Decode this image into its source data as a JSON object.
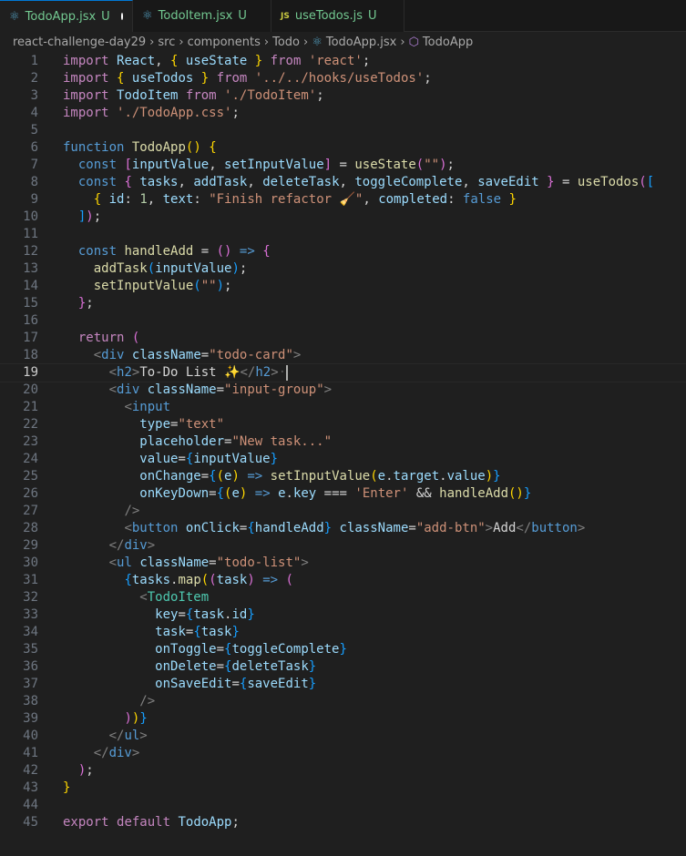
{
  "tabs": [
    {
      "label": "TodoApp.jsx",
      "status": "U",
      "icon": "react-icon",
      "modified": true,
      "active": true
    },
    {
      "label": "TodoItem.jsx",
      "status": "U",
      "icon": "react-icon",
      "modified": false,
      "active": false
    },
    {
      "label": "useTodos.js",
      "status": "U",
      "icon": "js-icon",
      "icon_text": "JS",
      "modified": false,
      "active": false
    }
  ],
  "breadcrumb": [
    "react-challenge-day29",
    "src",
    "components",
    "Todo",
    "TodoApp.jsx",
    "TodoApp"
  ],
  "current_line": 19,
  "lines": [
    [
      [
        "k",
        "import"
      ],
      [
        "o",
        " "
      ],
      [
        "v",
        "React"
      ],
      [
        "o",
        ", "
      ],
      [
        "b1",
        "{"
      ],
      [
        "o",
        " "
      ],
      [
        "v",
        "useState"
      ],
      [
        "o",
        " "
      ],
      [
        "b1",
        "}"
      ],
      [
        "o",
        " "
      ],
      [
        "k",
        "from"
      ],
      [
        "o",
        " "
      ],
      [
        "st",
        "'react'"
      ],
      [
        "o",
        ";"
      ]
    ],
    [
      [
        "k",
        "import"
      ],
      [
        "o",
        " "
      ],
      [
        "b1",
        "{"
      ],
      [
        "o",
        " "
      ],
      [
        "v",
        "useTodos"
      ],
      [
        "o",
        " "
      ],
      [
        "b1",
        "}"
      ],
      [
        "o",
        " "
      ],
      [
        "k",
        "from"
      ],
      [
        "o",
        " "
      ],
      [
        "st",
        "'../../hooks/useTodos'"
      ],
      [
        "o",
        ";"
      ]
    ],
    [
      [
        "k",
        "import"
      ],
      [
        "o",
        " "
      ],
      [
        "v",
        "TodoItem"
      ],
      [
        "o",
        " "
      ],
      [
        "k",
        "from"
      ],
      [
        "o",
        " "
      ],
      [
        "st",
        "'./TodoItem'"
      ],
      [
        "o",
        ";"
      ]
    ],
    [
      [
        "k",
        "import"
      ],
      [
        "o",
        " "
      ],
      [
        "st",
        "'./TodoApp.css'"
      ],
      [
        "o",
        ";"
      ]
    ],
    [],
    [
      [
        "s",
        "function"
      ],
      [
        "o",
        " "
      ],
      [
        "f",
        "TodoApp"
      ],
      [
        "b1",
        "()"
      ],
      [
        "o",
        " "
      ],
      [
        "b1",
        "{"
      ]
    ],
    [
      [
        "o",
        "  "
      ],
      [
        "s",
        "const"
      ],
      [
        "o",
        " "
      ],
      [
        "b2",
        "["
      ],
      [
        "v",
        "inputValue"
      ],
      [
        "o",
        ", "
      ],
      [
        "v",
        "setInputValue"
      ],
      [
        "b2",
        "]"
      ],
      [
        "o",
        " = "
      ],
      [
        "f",
        "useState"
      ],
      [
        "b2",
        "("
      ],
      [
        "st",
        "\"\""
      ],
      [
        "b2",
        ")"
      ],
      [
        "o",
        ";"
      ]
    ],
    [
      [
        "o",
        "  "
      ],
      [
        "s",
        "const"
      ],
      [
        "o",
        " "
      ],
      [
        "b2",
        "{"
      ],
      [
        "o",
        " "
      ],
      [
        "v",
        "tasks"
      ],
      [
        "o",
        ", "
      ],
      [
        "v",
        "addTask"
      ],
      [
        "o",
        ", "
      ],
      [
        "v",
        "deleteTask"
      ],
      [
        "o",
        ", "
      ],
      [
        "v",
        "toggleComplete"
      ],
      [
        "o",
        ", "
      ],
      [
        "v",
        "saveEdit"
      ],
      [
        "o",
        " "
      ],
      [
        "b2",
        "}"
      ],
      [
        "o",
        " = "
      ],
      [
        "f",
        "useTodos"
      ],
      [
        "b2",
        "("
      ],
      [
        "b3",
        "["
      ]
    ],
    [
      [
        "o",
        "    "
      ],
      [
        "b1",
        "{"
      ],
      [
        "o",
        " "
      ],
      [
        "v",
        "id"
      ],
      [
        "o",
        ": "
      ],
      [
        "n",
        "1"
      ],
      [
        "o",
        ", "
      ],
      [
        "v",
        "text"
      ],
      [
        "o",
        ": "
      ],
      [
        "st",
        "\"Finish refactor 🧹\""
      ],
      [
        "o",
        ", "
      ],
      [
        "v",
        "completed"
      ],
      [
        "o",
        ": "
      ],
      [
        "s",
        "false"
      ],
      [
        "o",
        " "
      ],
      [
        "b1",
        "}"
      ]
    ],
    [
      [
        "o",
        "  "
      ],
      [
        "b3",
        "]"
      ],
      [
        "b2",
        ")"
      ],
      [
        "o",
        ";"
      ]
    ],
    [],
    [
      [
        "o",
        "  "
      ],
      [
        "s",
        "const"
      ],
      [
        "o",
        " "
      ],
      [
        "f",
        "handleAdd"
      ],
      [
        "o",
        " = "
      ],
      [
        "b2",
        "()"
      ],
      [
        "o",
        " "
      ],
      [
        "s",
        "=>"
      ],
      [
        "o",
        " "
      ],
      [
        "b2",
        "{"
      ]
    ],
    [
      [
        "o",
        "    "
      ],
      [
        "f",
        "addTask"
      ],
      [
        "b3",
        "("
      ],
      [
        "v",
        "inputValue"
      ],
      [
        "b3",
        ")"
      ],
      [
        "o",
        ";"
      ]
    ],
    [
      [
        "o",
        "    "
      ],
      [
        "f",
        "setInputValue"
      ],
      [
        "b3",
        "("
      ],
      [
        "st",
        "\"\""
      ],
      [
        "b3",
        ")"
      ],
      [
        "o",
        ";"
      ]
    ],
    [
      [
        "o",
        "  "
      ],
      [
        "b2",
        "}"
      ],
      [
        "o",
        ";"
      ]
    ],
    [],
    [
      [
        "o",
        "  "
      ],
      [
        "k",
        "return"
      ],
      [
        "o",
        " "
      ],
      [
        "b2",
        "("
      ]
    ],
    [
      [
        "o",
        "    "
      ],
      [
        "p",
        "<"
      ],
      [
        "t",
        "div"
      ],
      [
        "o",
        " "
      ],
      [
        "v",
        "className"
      ],
      [
        "o",
        "="
      ],
      [
        "st",
        "\"todo-card\""
      ],
      [
        "p",
        ">"
      ]
    ],
    [
      [
        "o",
        "      "
      ],
      [
        "p",
        "<"
      ],
      [
        "t",
        "h2"
      ],
      [
        "p",
        ">"
      ],
      [
        "o",
        "To-Do List ✨"
      ],
      [
        "p",
        "</"
      ],
      [
        "t",
        "h2"
      ],
      [
        "p",
        ">"
      ],
      [
        "ws",
        "·"
      ]
    ],
    [
      [
        "o",
        "      "
      ],
      [
        "p",
        "<"
      ],
      [
        "t",
        "div"
      ],
      [
        "o",
        " "
      ],
      [
        "v",
        "className"
      ],
      [
        "o",
        "="
      ],
      [
        "st",
        "\"input-group\""
      ],
      [
        "p",
        ">"
      ]
    ],
    [
      [
        "o",
        "        "
      ],
      [
        "p",
        "<"
      ],
      [
        "t",
        "input"
      ]
    ],
    [
      [
        "o",
        "          "
      ],
      [
        "v",
        "type"
      ],
      [
        "o",
        "="
      ],
      [
        "st",
        "\"text\""
      ]
    ],
    [
      [
        "o",
        "          "
      ],
      [
        "v",
        "placeholder"
      ],
      [
        "o",
        "="
      ],
      [
        "st",
        "\"New task...\""
      ]
    ],
    [
      [
        "o",
        "          "
      ],
      [
        "v",
        "value"
      ],
      [
        "o",
        "="
      ],
      [
        "b3",
        "{"
      ],
      [
        "v",
        "inputValue"
      ],
      [
        "b3",
        "}"
      ]
    ],
    [
      [
        "o",
        "          "
      ],
      [
        "v",
        "onChange"
      ],
      [
        "o",
        "="
      ],
      [
        "b3",
        "{"
      ],
      [
        "b1",
        "("
      ],
      [
        "v",
        "e"
      ],
      [
        "b1",
        ")"
      ],
      [
        "o",
        " "
      ],
      [
        "s",
        "=>"
      ],
      [
        "o",
        " "
      ],
      [
        "f",
        "setInputValue"
      ],
      [
        "b1",
        "("
      ],
      [
        "v",
        "e"
      ],
      [
        "o",
        "."
      ],
      [
        "v",
        "target"
      ],
      [
        "o",
        "."
      ],
      [
        "v",
        "value"
      ],
      [
        "b1",
        ")"
      ],
      [
        "b3",
        "}"
      ]
    ],
    [
      [
        "o",
        "          "
      ],
      [
        "v",
        "onKeyDown"
      ],
      [
        "o",
        "="
      ],
      [
        "b3",
        "{"
      ],
      [
        "b1",
        "("
      ],
      [
        "v",
        "e"
      ],
      [
        "b1",
        ")"
      ],
      [
        "o",
        " "
      ],
      [
        "s",
        "=>"
      ],
      [
        "o",
        " "
      ],
      [
        "v",
        "e"
      ],
      [
        "o",
        "."
      ],
      [
        "v",
        "key"
      ],
      [
        "o",
        " === "
      ],
      [
        "st",
        "'Enter'"
      ],
      [
        "o",
        " && "
      ],
      [
        "f",
        "handleAdd"
      ],
      [
        "b1",
        "()"
      ],
      [
        "b3",
        "}"
      ]
    ],
    [
      [
        "o",
        "        "
      ],
      [
        "p",
        "/>"
      ]
    ],
    [
      [
        "o",
        "        "
      ],
      [
        "p",
        "<"
      ],
      [
        "t",
        "button"
      ],
      [
        "o",
        " "
      ],
      [
        "v",
        "onClick"
      ],
      [
        "o",
        "="
      ],
      [
        "b3",
        "{"
      ],
      [
        "v",
        "handleAdd"
      ],
      [
        "b3",
        "}"
      ],
      [
        "o",
        " "
      ],
      [
        "v",
        "className"
      ],
      [
        "o",
        "="
      ],
      [
        "st",
        "\"add-btn\""
      ],
      [
        "p",
        ">"
      ],
      [
        "o",
        "Add"
      ],
      [
        "p",
        "</"
      ],
      [
        "t",
        "button"
      ],
      [
        "p",
        ">"
      ]
    ],
    [
      [
        "o",
        "      "
      ],
      [
        "p",
        "</"
      ],
      [
        "t",
        "div"
      ],
      [
        "p",
        ">"
      ]
    ],
    [
      [
        "o",
        "      "
      ],
      [
        "p",
        "<"
      ],
      [
        "t",
        "ul"
      ],
      [
        "o",
        " "
      ],
      [
        "v",
        "className"
      ],
      [
        "o",
        "="
      ],
      [
        "st",
        "\"todo-list\""
      ],
      [
        "p",
        ">"
      ]
    ],
    [
      [
        "o",
        "        "
      ],
      [
        "b3",
        "{"
      ],
      [
        "v",
        "tasks"
      ],
      [
        "o",
        "."
      ],
      [
        "f",
        "map"
      ],
      [
        "b1",
        "("
      ],
      [
        "b2",
        "("
      ],
      [
        "v",
        "task"
      ],
      [
        "b2",
        ")"
      ],
      [
        "o",
        " "
      ],
      [
        "s",
        "=>"
      ],
      [
        "o",
        " "
      ],
      [
        "b2",
        "("
      ]
    ],
    [
      [
        "o",
        "          "
      ],
      [
        "p",
        "<"
      ],
      [
        "c",
        "TodoItem"
      ]
    ],
    [
      [
        "o",
        "            "
      ],
      [
        "v",
        "key"
      ],
      [
        "o",
        "="
      ],
      [
        "b3",
        "{"
      ],
      [
        "v",
        "task"
      ],
      [
        "o",
        "."
      ],
      [
        "v",
        "id"
      ],
      [
        "b3",
        "}"
      ]
    ],
    [
      [
        "o",
        "            "
      ],
      [
        "v",
        "task"
      ],
      [
        "o",
        "="
      ],
      [
        "b3",
        "{"
      ],
      [
        "v",
        "task"
      ],
      [
        "b3",
        "}"
      ]
    ],
    [
      [
        "o",
        "            "
      ],
      [
        "v",
        "onToggle"
      ],
      [
        "o",
        "="
      ],
      [
        "b3",
        "{"
      ],
      [
        "v",
        "toggleComplete"
      ],
      [
        "b3",
        "}"
      ]
    ],
    [
      [
        "o",
        "            "
      ],
      [
        "v",
        "onDelete"
      ],
      [
        "o",
        "="
      ],
      [
        "b3",
        "{"
      ],
      [
        "v",
        "deleteTask"
      ],
      [
        "b3",
        "}"
      ]
    ],
    [
      [
        "o",
        "            "
      ],
      [
        "v",
        "onSaveEdit"
      ],
      [
        "o",
        "="
      ],
      [
        "b3",
        "{"
      ],
      [
        "v",
        "saveEdit"
      ],
      [
        "b3",
        "}"
      ]
    ],
    [
      [
        "o",
        "          "
      ],
      [
        "p",
        "/>"
      ]
    ],
    [
      [
        "o",
        "        "
      ],
      [
        "b2",
        ")"
      ],
      [
        "b1",
        ")"
      ],
      [
        "b3",
        "}"
      ]
    ],
    [
      [
        "o",
        "      "
      ],
      [
        "p",
        "</"
      ],
      [
        "t",
        "ul"
      ],
      [
        "p",
        ">"
      ]
    ],
    [
      [
        "o",
        "    "
      ],
      [
        "p",
        "</"
      ],
      [
        "t",
        "div"
      ],
      [
        "p",
        ">"
      ]
    ],
    [
      [
        "o",
        "  "
      ],
      [
        "b2",
        ")"
      ],
      [
        "o",
        ";"
      ]
    ],
    [
      [
        "b1",
        "}"
      ]
    ],
    [],
    [
      [
        "k",
        "export"
      ],
      [
        "o",
        " "
      ],
      [
        "k",
        "default"
      ],
      [
        "o",
        " "
      ],
      [
        "v",
        "TodoApp"
      ],
      [
        "o",
        ";"
      ]
    ]
  ]
}
